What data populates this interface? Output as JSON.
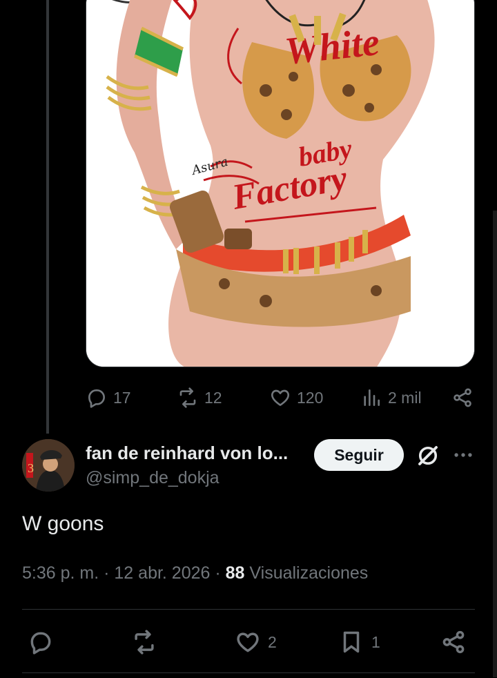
{
  "quoted_tweet": {
    "media_alt": "",
    "artwork_text": [
      "White",
      "baby Factory"
    ],
    "artist_signature": "Asura",
    "stats": {
      "replies": "17",
      "retweets": "12",
      "likes": "120",
      "views": "2 mil"
    }
  },
  "reply": {
    "author": {
      "display_name": "fan de reinhard von lo...",
      "handle": "@simp_de_dokja"
    },
    "follow_label": "Seguir",
    "text": "W goons",
    "meta": {
      "time": "5:36 p. m.",
      "separator": "·",
      "date": "12 abr. 2026",
      "views_count": "88",
      "views_label": "Visualizaciones"
    },
    "stats": {
      "likes": "2",
      "bookmarks": "1"
    }
  },
  "icons": {
    "reply": "reply-icon",
    "retweet": "retweet-icon",
    "like": "heart-icon",
    "views": "views-chart-icon",
    "share": "share-icon",
    "bookmark": "bookmark-icon",
    "grok": "grok-icon",
    "more": "more-dots-icon"
  },
  "colors": {
    "background": "#000000",
    "text_primary": "#e7e9ea",
    "text_secondary": "#71767b",
    "divider": "#2f3336",
    "follow_button_bg": "#eff3f4"
  }
}
